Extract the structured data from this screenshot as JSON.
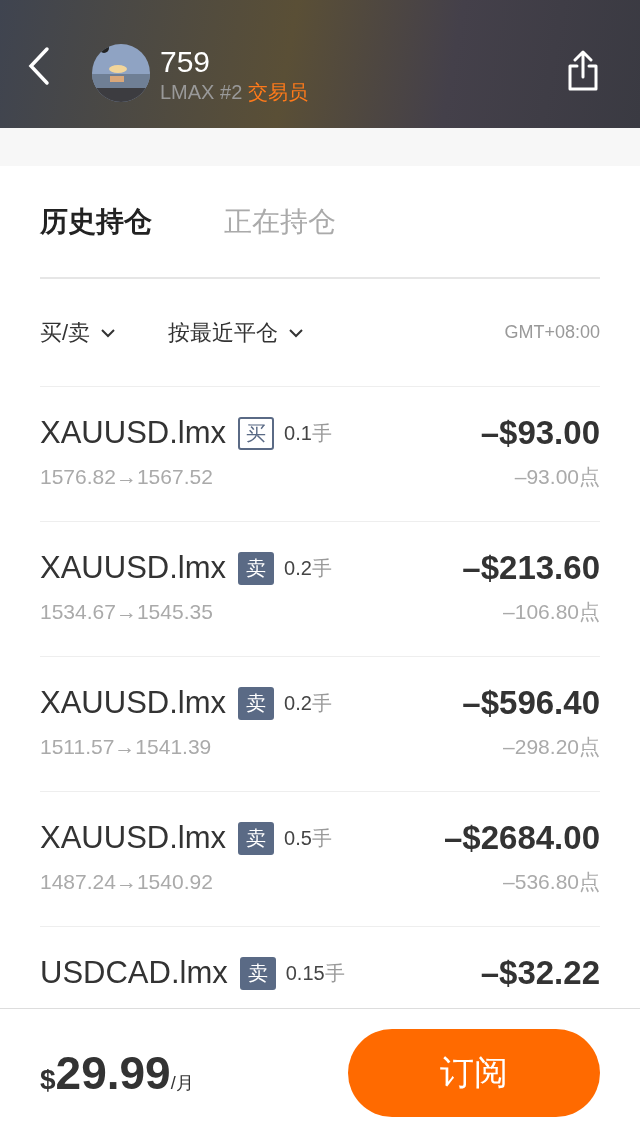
{
  "header": {
    "title": "759",
    "broker": "LMAX #2",
    "role": "交易员"
  },
  "tabs": [
    {
      "label": "历史持仓",
      "selected": true
    },
    {
      "label": "正在持仓",
      "selected": false
    }
  ],
  "filters": [
    {
      "label": "买/卖"
    },
    {
      "label": "按最近平仓"
    }
  ],
  "timezone": "GMT+08:00",
  "trades": [
    {
      "symbol": "XAUUSD.lmx",
      "kind": "buy",
      "side": "买",
      "lots": "0.1",
      "unit": "手",
      "prices": "1576.82→1567.52",
      "profit": "–$93.00",
      "points": "–93.00点"
    },
    {
      "symbol": "XAUUSD.lmx",
      "kind": "sell",
      "side": "卖",
      "lots": "0.2",
      "unit": "手",
      "prices": "1534.67→1545.35",
      "profit": "–$213.60",
      "points": "–106.80点"
    },
    {
      "symbol": "XAUUSD.lmx",
      "kind": "sell",
      "side": "卖",
      "lots": "0.2",
      "unit": "手",
      "prices": "1511.57→1541.39",
      "profit": "–$596.40",
      "points": "–298.20点"
    },
    {
      "symbol": "XAUUSD.lmx",
      "kind": "sell",
      "side": "卖",
      "lots": "0.5",
      "unit": "手",
      "prices": "1487.24→1540.92",
      "profit": "–$2684.00",
      "points": "–536.80点"
    },
    {
      "symbol": "USDCAD.lmx",
      "kind": "sell",
      "side": "卖",
      "lots": "0.15",
      "unit": "手",
      "profit": "–$32.22"
    }
  ],
  "footer": {
    "currency": "$",
    "price": "29.99",
    "period": "/月",
    "button": "订阅"
  }
}
